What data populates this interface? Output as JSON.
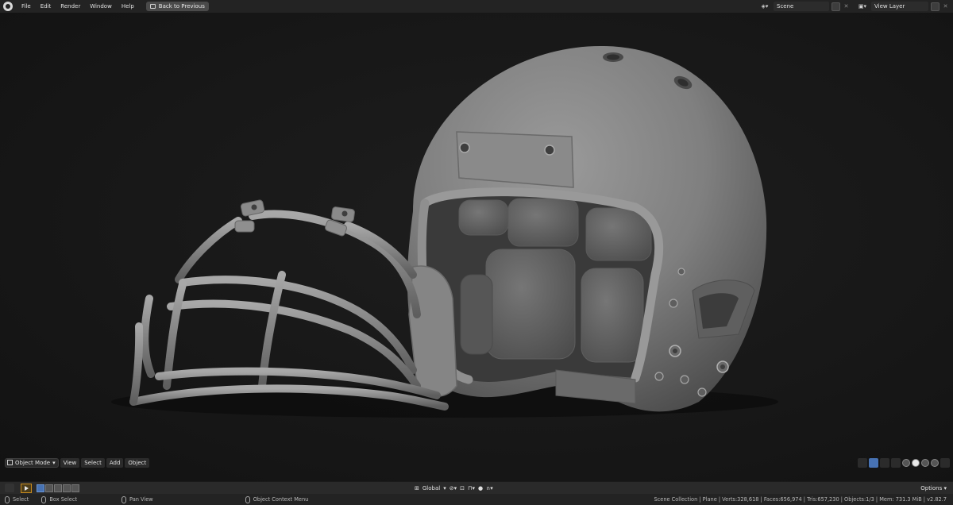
{
  "menu": [
    "File",
    "Edit",
    "Render",
    "Window",
    "Help"
  ],
  "back_button": "Back to Previous",
  "scene": {
    "name": "Scene",
    "view_layer": "View Layer"
  },
  "viewport_header": {
    "mode": "Object Mode",
    "menus": [
      "View",
      "Select",
      "Add",
      "Object"
    ]
  },
  "toolbar": {
    "orientation": "Global",
    "options": "Options"
  },
  "statusbar": {
    "select": "Select",
    "box_select": "Box Select",
    "pan_view": "Pan View",
    "context_menu": "Object Context Menu",
    "stats": "Scene Collection | Plane | Verts:328,618 | Faces:656,974 | Tris:657,230 | Objects:1/3 | Mem: 731.3 MiB | v2.82.7"
  },
  "colors": {
    "accent": "#4772b3",
    "active_tool": "#c98b1d",
    "model": "#7a7a7a"
  }
}
